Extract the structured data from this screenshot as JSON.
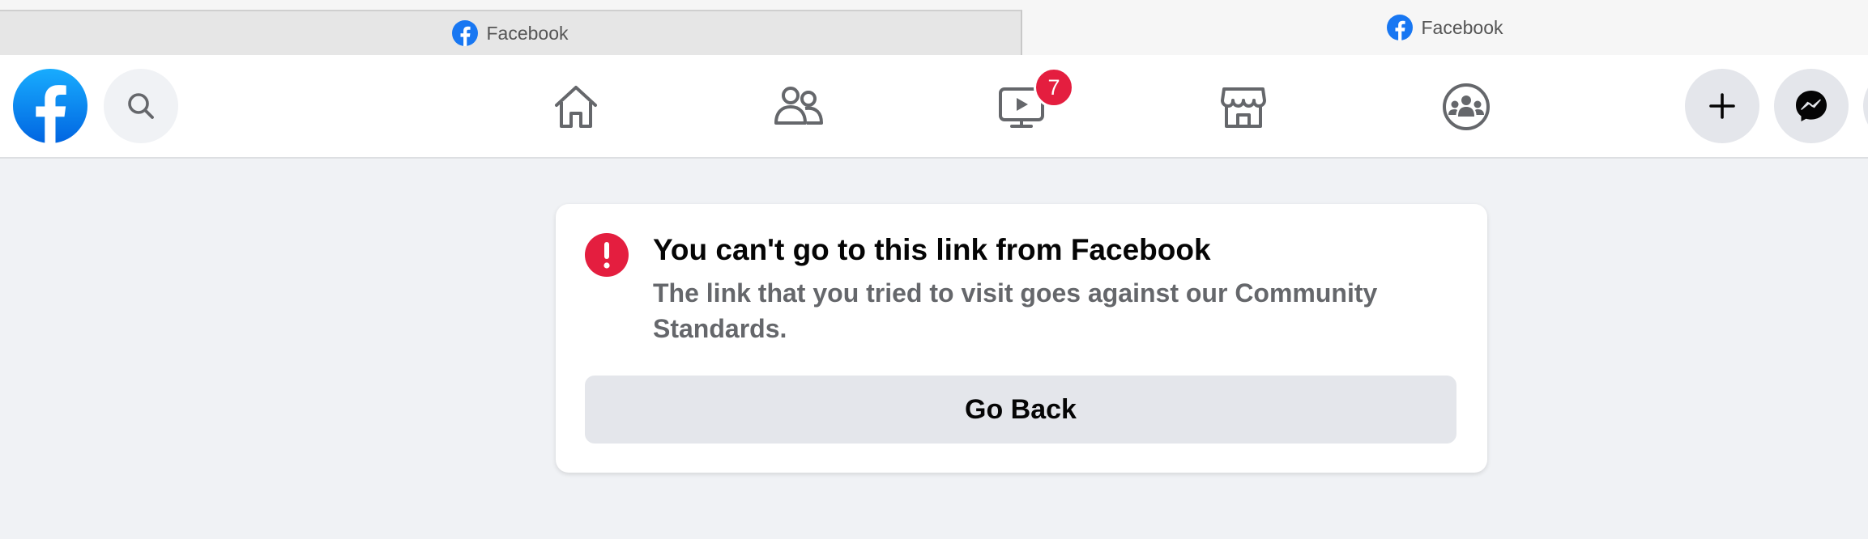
{
  "browser": {
    "tabs": [
      {
        "title": "Facebook",
        "active": false
      },
      {
        "title": "Facebook",
        "active": true
      }
    ]
  },
  "nav": {
    "icons": [
      "facebook-logo",
      "search-icon",
      "home-icon",
      "friends-icon",
      "watch-icon",
      "marketplace-icon",
      "groups-icon",
      "plus-icon",
      "messenger-icon"
    ],
    "watch_badge": "7"
  },
  "error": {
    "title": "You can't go to this link from Facebook",
    "message": "The link that you tried to visit goes against our Community Standards.",
    "button_label": "Go Back"
  },
  "colors": {
    "brand": "#1877f2",
    "badge": "#e41e3f",
    "page_bg": "#f0f2f5",
    "muted_text": "#65676b"
  }
}
